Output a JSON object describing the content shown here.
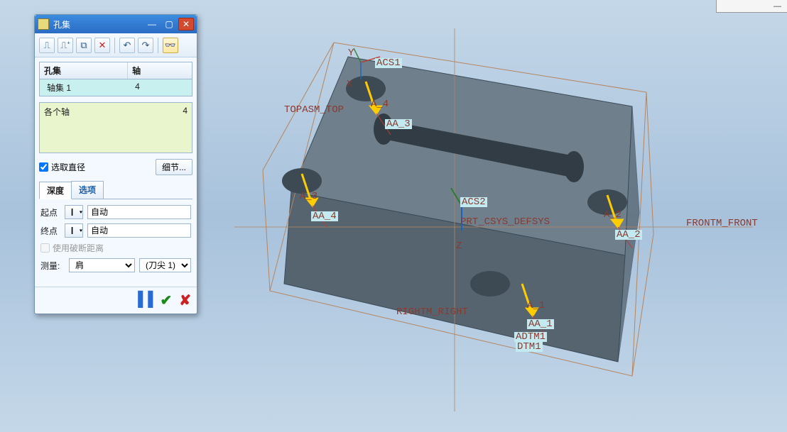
{
  "window": {
    "title": "孔集"
  },
  "toolbar": {
    "icons": [
      "add-hole-icon",
      "add-group-icon",
      "copy-icon",
      "delete-icon",
      "undo-icon",
      "redo-icon",
      "preview-icon"
    ]
  },
  "grid": {
    "col1": "孔集",
    "col2": "轴",
    "row_name": "轴集 1",
    "row_val": "4"
  },
  "infobox": {
    "left": "各个轴",
    "right": "4"
  },
  "options": {
    "pick_diameter": "选取直径",
    "detail_btn": "细节..."
  },
  "tabs": {
    "depth": "深度",
    "options": "选项"
  },
  "depth": {
    "start_lbl": "起点",
    "end_lbl": "终点",
    "auto": "自动",
    "use_break": "使用破断距离",
    "measure_lbl": "测量:",
    "measure_val": "肩",
    "tip_val": "(刀尖 1)"
  },
  "viewport": {
    "labels": {
      "topasm": "TOPASM_TOP",
      "frontm": "FRONTM_FRONT",
      "rightm": "RIGHTM_RIGHT",
      "acs1": "ACS1",
      "acs2": "ACS2",
      "prt": "PRT_CSYS_DEFSYS",
      "dtm1a": "ADTM1",
      "dtm1b": "DTM1",
      "a1": "A_1",
      "aa1": "AA_1",
      "a2": "A_2",
      "aa2": "AA_2",
      "a3": "A_3",
      "aa3": "AA_3",
      "a4": "A_4",
      "aa4": "AA_4",
      "x": "X",
      "y": "Y",
      "z": "Z"
    }
  }
}
